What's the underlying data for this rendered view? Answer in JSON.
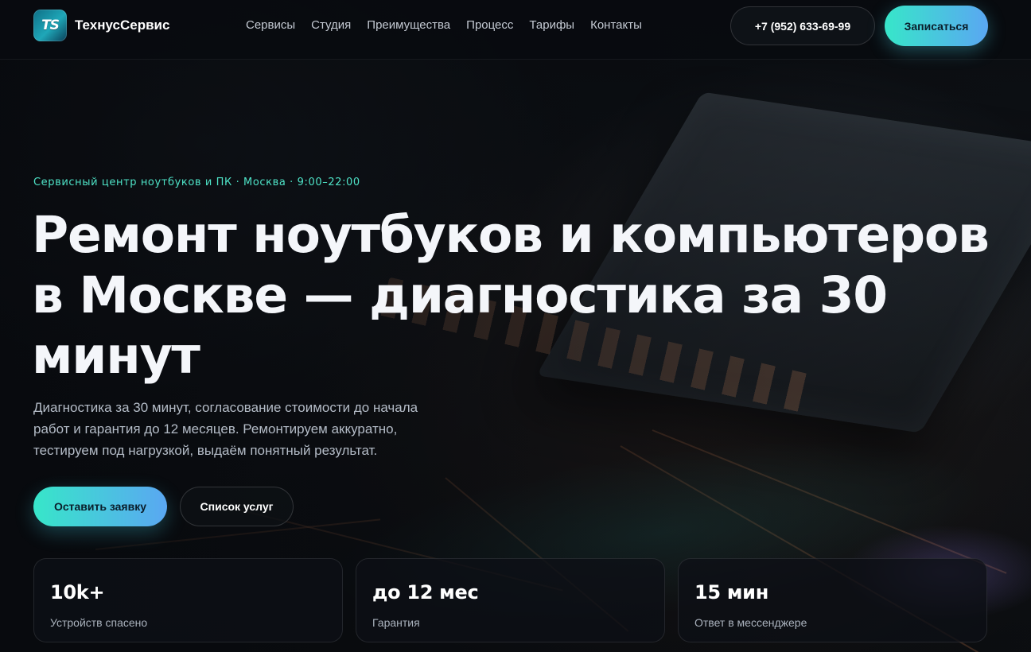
{
  "brand": {
    "logo_mark": "TS",
    "name": "ТехнусСервис",
    "accent_gradient": [
      "#37e6c9",
      "#5aa7f2"
    ],
    "eyebrow_color": "#4ee3c7"
  },
  "nav": {
    "items": [
      {
        "label": "Сервисы"
      },
      {
        "label": "Студия"
      },
      {
        "label": "Преимущества"
      },
      {
        "label": "Процесс"
      },
      {
        "label": "Тарифы"
      },
      {
        "label": "Контакты"
      }
    ]
  },
  "header": {
    "phone": "+7 (952) 633-69-99",
    "cta_label": "Записаться"
  },
  "hero": {
    "eyebrow": "Сервисный центр ноутбуков и ПК · Москва · 9:00–22:00",
    "title": "Ремонт ноутбуков и компьютеров в Москве — диагностика за 30 минут",
    "lead": "Диагностика за 30 минут, согласование стоимости до начала работ и гарантия до 12 месяцев. Ремонтируем аккуратно, тестируем под нагрузкой, выдаём понятный результат.",
    "primary_button": "Оставить заявку",
    "secondary_button": "Список услуг"
  },
  "stats": [
    {
      "value": "10k+",
      "label": "Устройств спасено"
    },
    {
      "value": "до 12 мес",
      "label": "Гарантия"
    },
    {
      "value": "15 мин",
      "label": "Ответ в мессенджере"
    }
  ]
}
